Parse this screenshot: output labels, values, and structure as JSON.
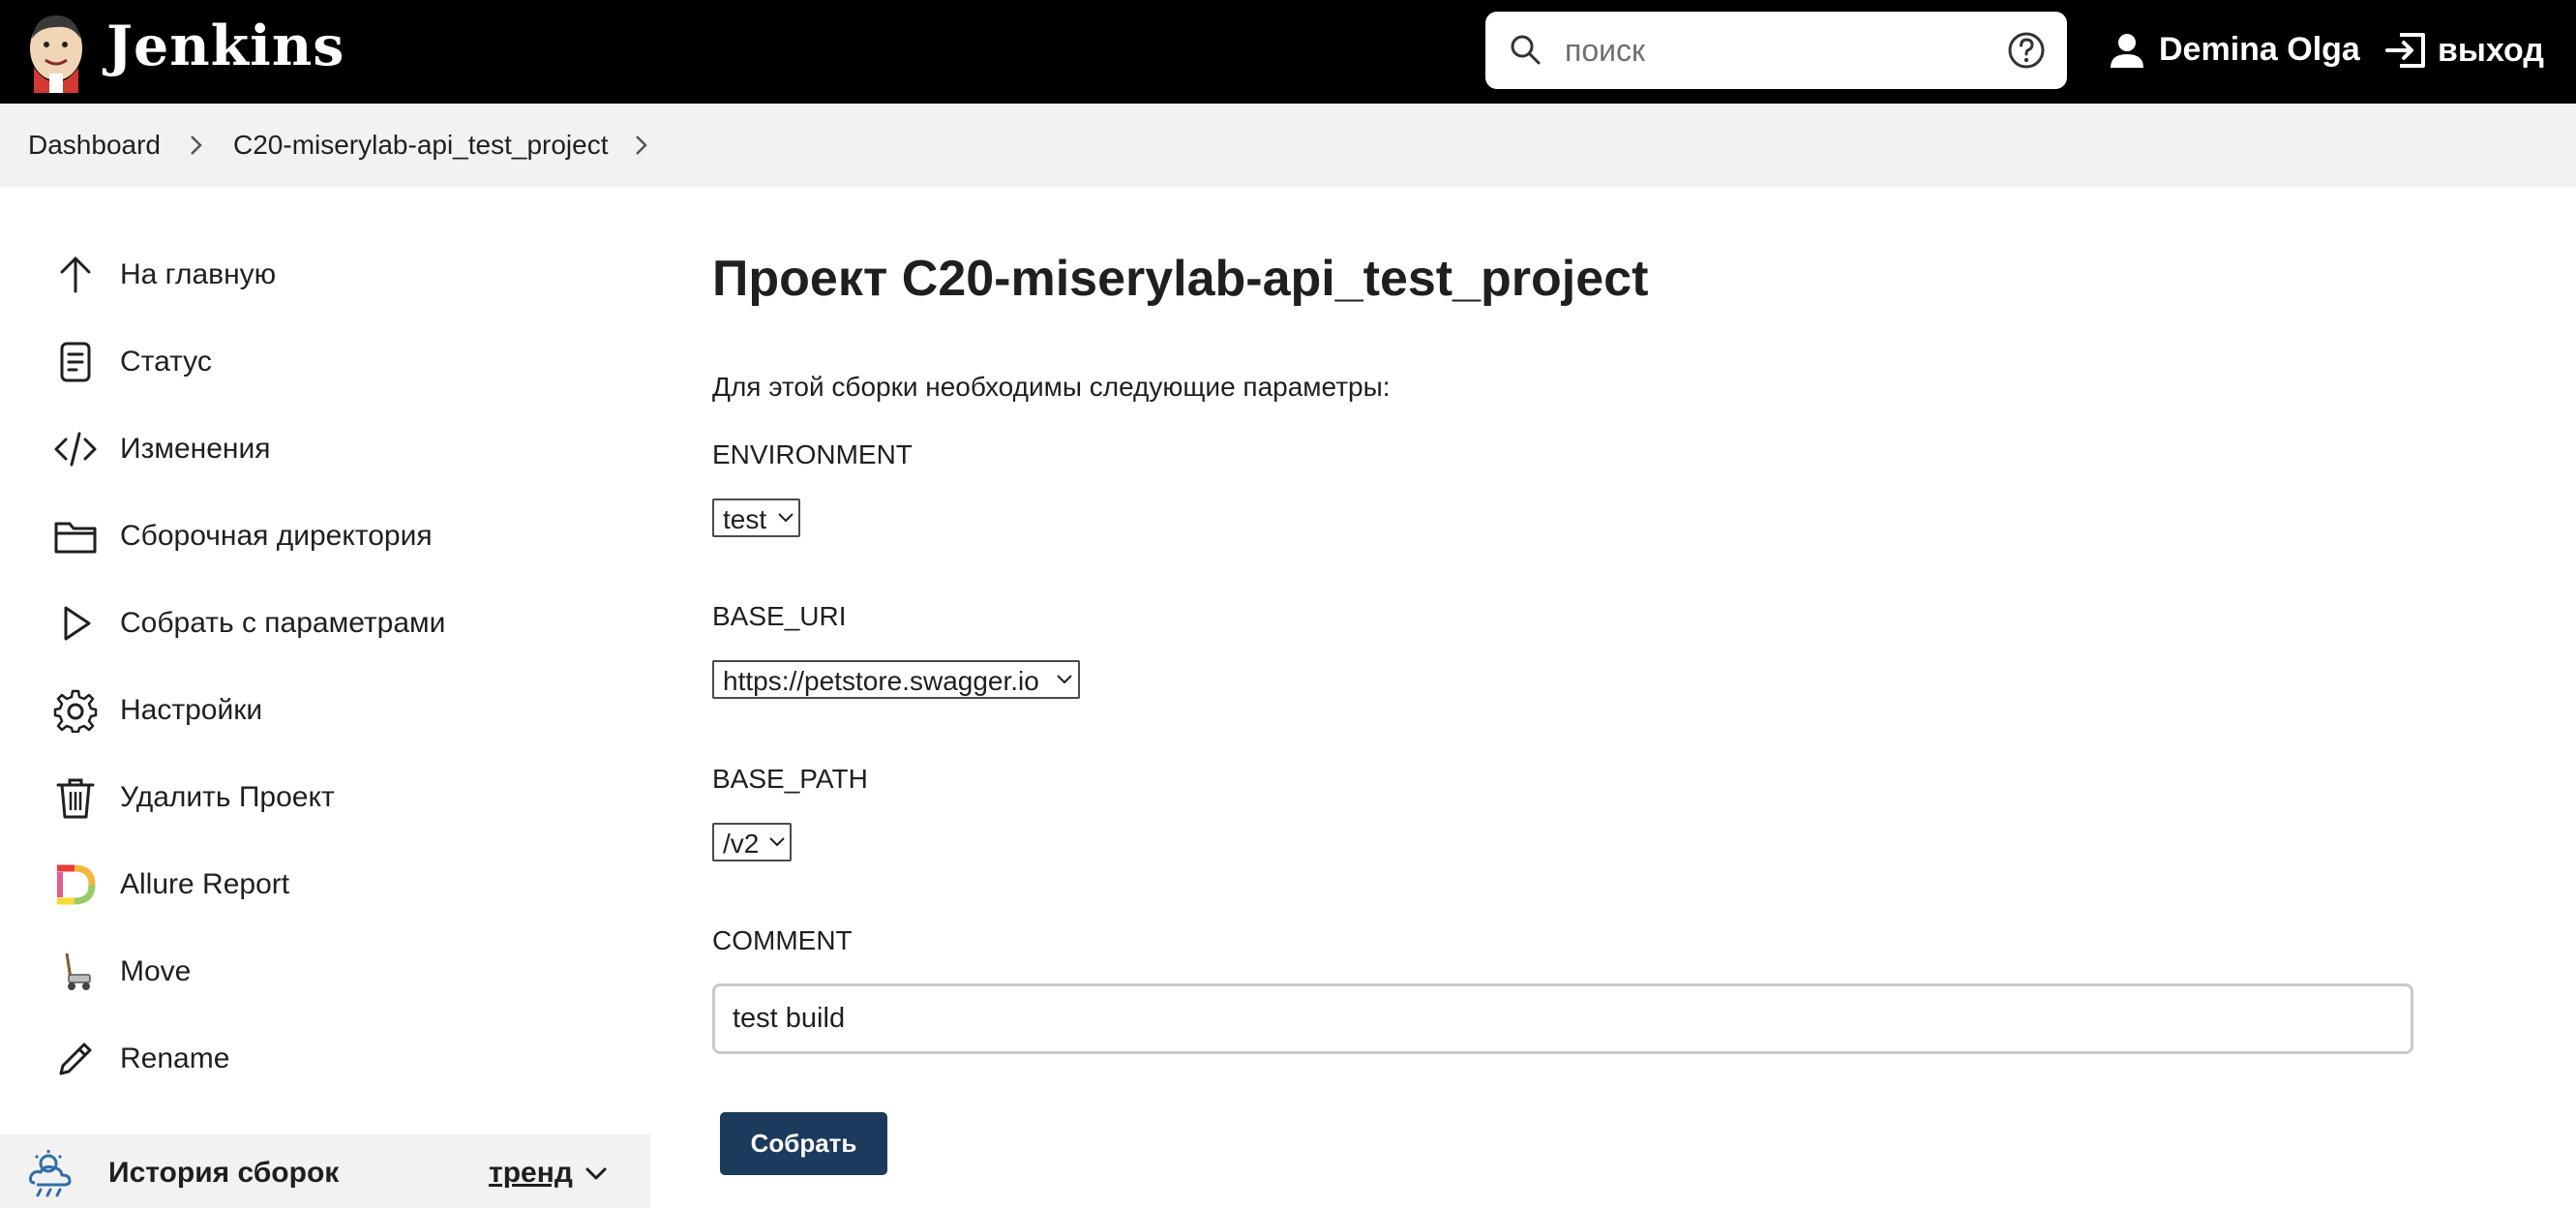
{
  "header": {
    "brand": "Jenkins",
    "search": {
      "placeholder": "поиск",
      "value": ""
    },
    "user_name": "Demina Olga",
    "logout_label": "выход"
  },
  "breadcrumb": {
    "items": [
      "Dashboard",
      "C20-miserylab-api_test_project"
    ]
  },
  "sidebar": {
    "items": [
      {
        "label": "На главную",
        "icon": "arrow-up-icon"
      },
      {
        "label": "Статус",
        "icon": "document-icon"
      },
      {
        "label": "Изменения",
        "icon": "code-icon"
      },
      {
        "label": "Сборочная директория",
        "icon": "folder-icon"
      },
      {
        "label": "Собрать с параметрами",
        "icon": "play-icon"
      },
      {
        "label": "Настройки",
        "icon": "gear-icon"
      },
      {
        "label": "Удалить Проект",
        "icon": "trash-icon"
      },
      {
        "label": "Allure Report",
        "icon": "allure-icon"
      },
      {
        "label": "Move",
        "icon": "move-icon"
      },
      {
        "label": "Rename",
        "icon": "pencil-icon"
      }
    ],
    "build_history": {
      "title": "История сборок",
      "trend_label": "тренд"
    }
  },
  "main": {
    "title": "Проект C20-miserylab-api_test_project",
    "intro": "Для этой сборки необходимы следующие параметры:",
    "params": [
      {
        "name": "ENVIRONMENT",
        "value": "test"
      },
      {
        "name": "BASE_URI",
        "value": "https://petstore.swagger.io"
      },
      {
        "name": "BASE_PATH",
        "value": "/v2"
      },
      {
        "name": "COMMENT",
        "value": "test build"
      }
    ],
    "submit_label": "Собрать"
  },
  "colors": {
    "header_bg": "#000000",
    "breadcrumb_bg": "#f2f2f2",
    "button_bg": "#1b3a5c"
  }
}
